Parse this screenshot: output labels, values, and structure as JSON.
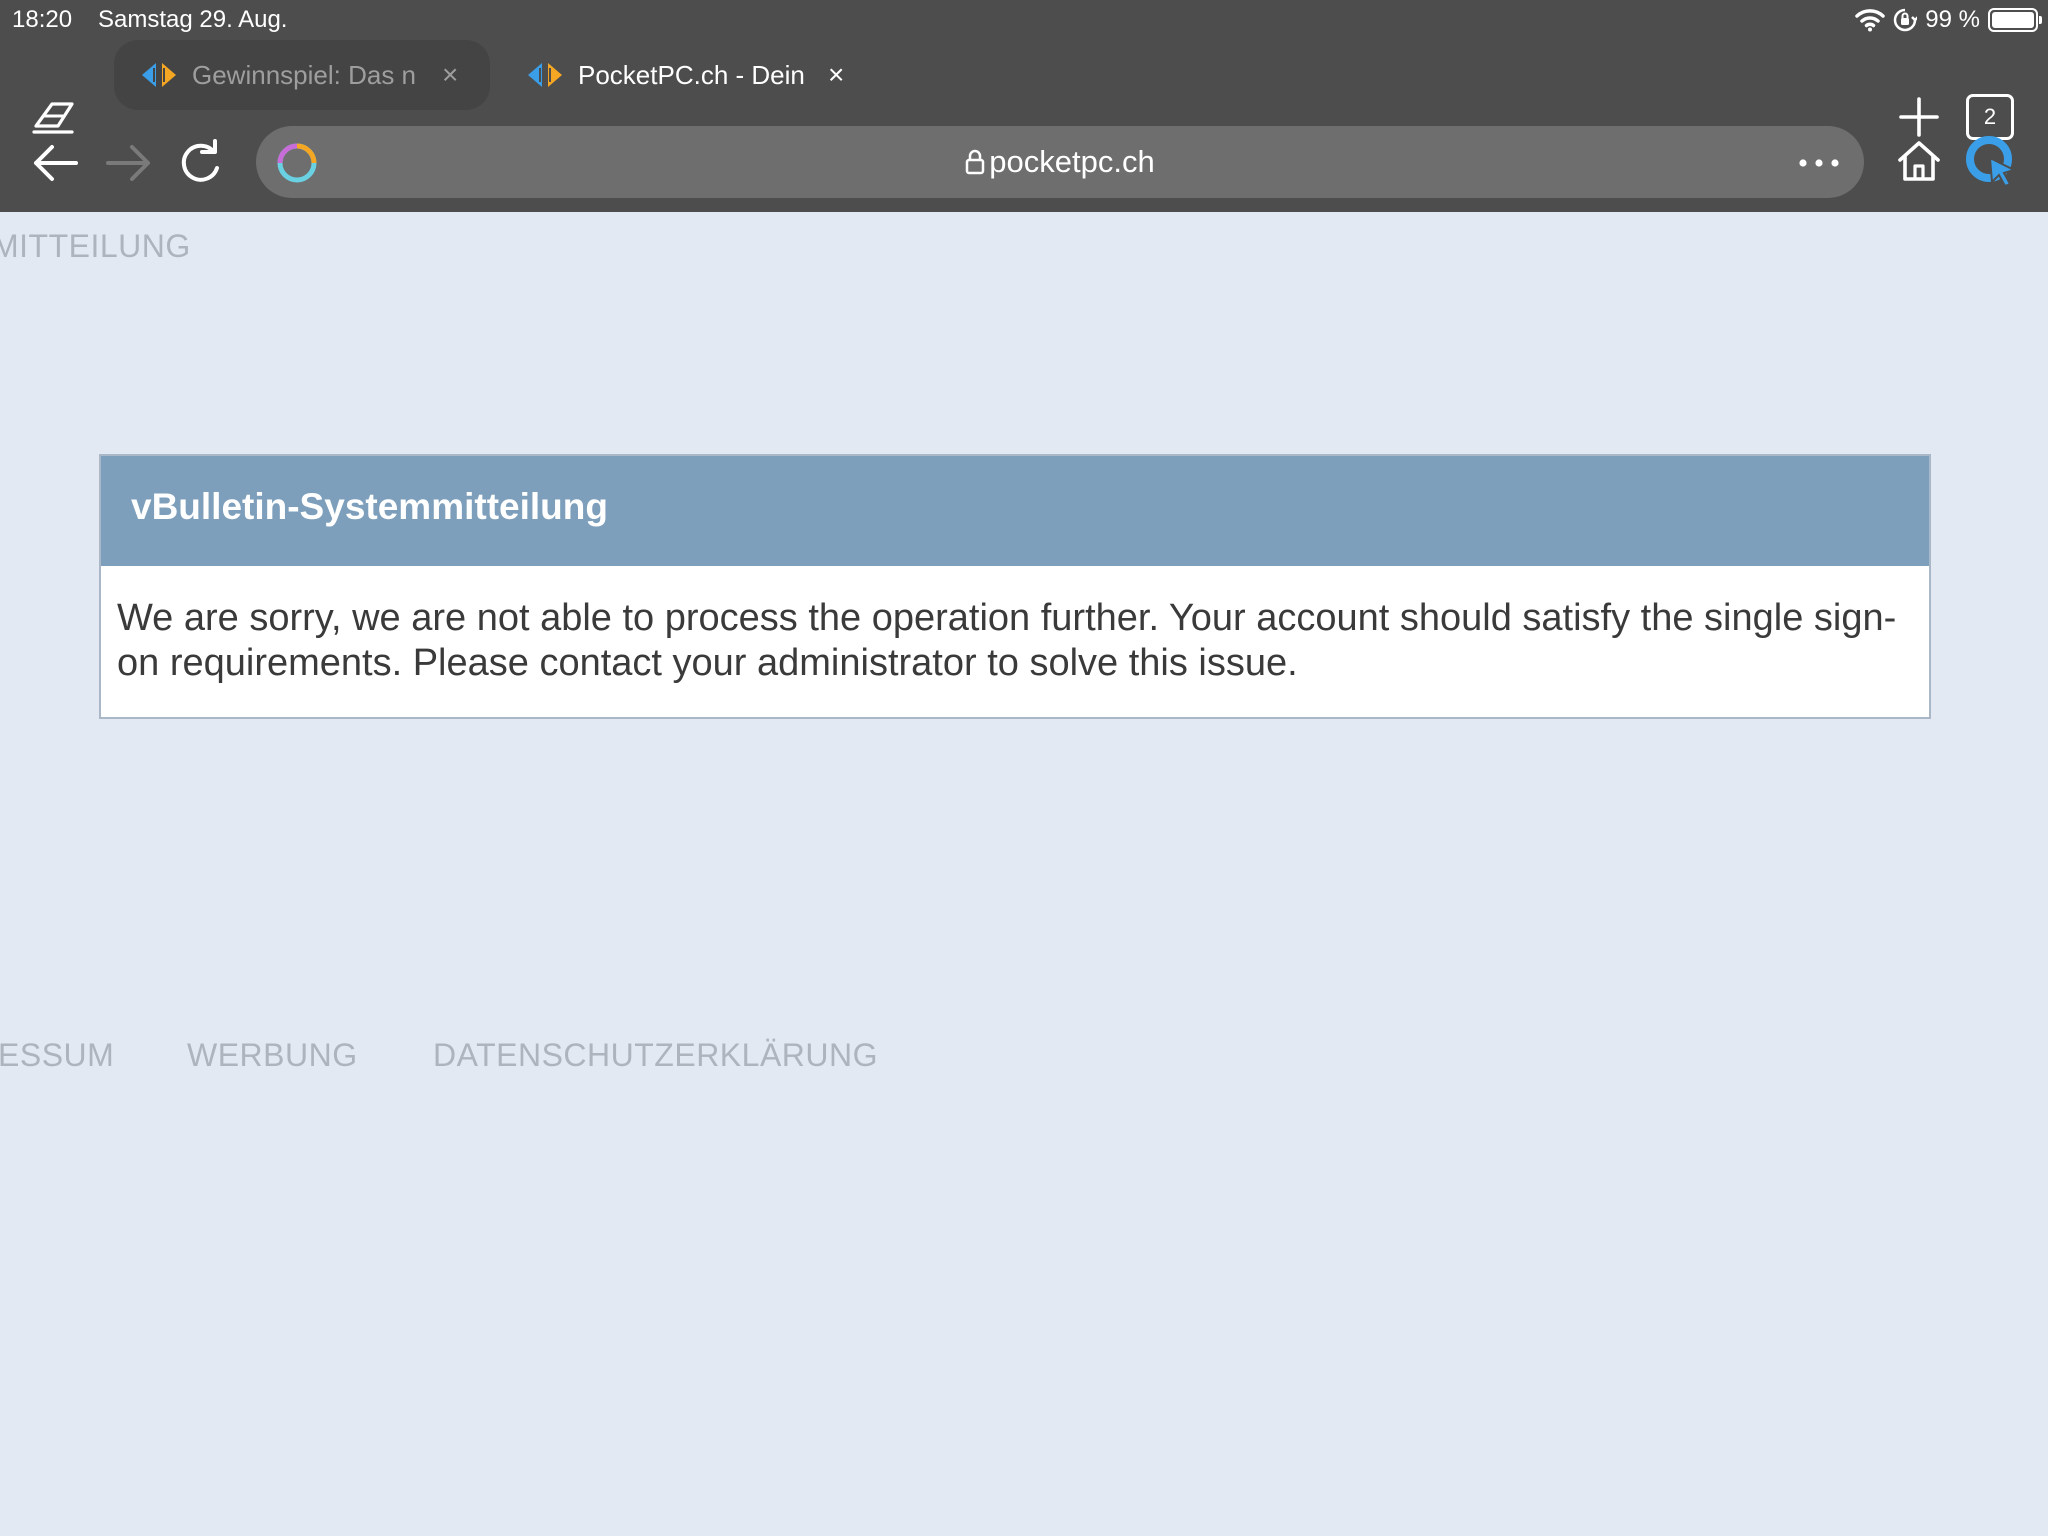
{
  "status_bar": {
    "time": "18:20",
    "date": "Samstag 29. Aug.",
    "battery_percent": "99 %",
    "battery_level": 0.99
  },
  "tabs": [
    {
      "title": "Gewinnspiel: Das n",
      "close": "×",
      "active": false
    },
    {
      "title": "PocketPC.ch - Dein",
      "close": "×",
      "active": true
    }
  ],
  "tab_count": "2",
  "address_bar": {
    "url": "pocketpc.ch"
  },
  "page": {
    "heading": "MITTEILUNG",
    "message": {
      "title": "vBulletin-Systemmitteilung",
      "body": "We are sorry, we are not able to process the operation further. Your account should satisfy the single sign-on requirements. Please contact your administrator to solve this issue."
    },
    "footer_links": [
      "ESSUM",
      "WERBUNG",
      "DATENSCHUTZERKLÄRUNG"
    ]
  },
  "colors": {
    "chrome_bg": "#4d4d4d",
    "page_bg": "#e2e9f3",
    "message_header_bg": "#7e9fbb",
    "muted_text": "#adb4be",
    "brand_blue": "#3a9fe8"
  },
  "icons": {
    "incognito": "eraser-icon",
    "new_tab": "plus-icon",
    "back": "arrow-left-icon",
    "forward": "arrow-right-icon",
    "reload": "reload-icon",
    "loading": "loading-spinner-icon",
    "secure": "lock-icon",
    "more": "more-dots-icon",
    "home": "home-icon",
    "brand": "browser-brand-icon",
    "wifi": "wifi-icon",
    "rotation_lock": "rotation-lock-icon",
    "battery": "battery-icon",
    "favicon": "pocketpc-favicon-icon"
  }
}
